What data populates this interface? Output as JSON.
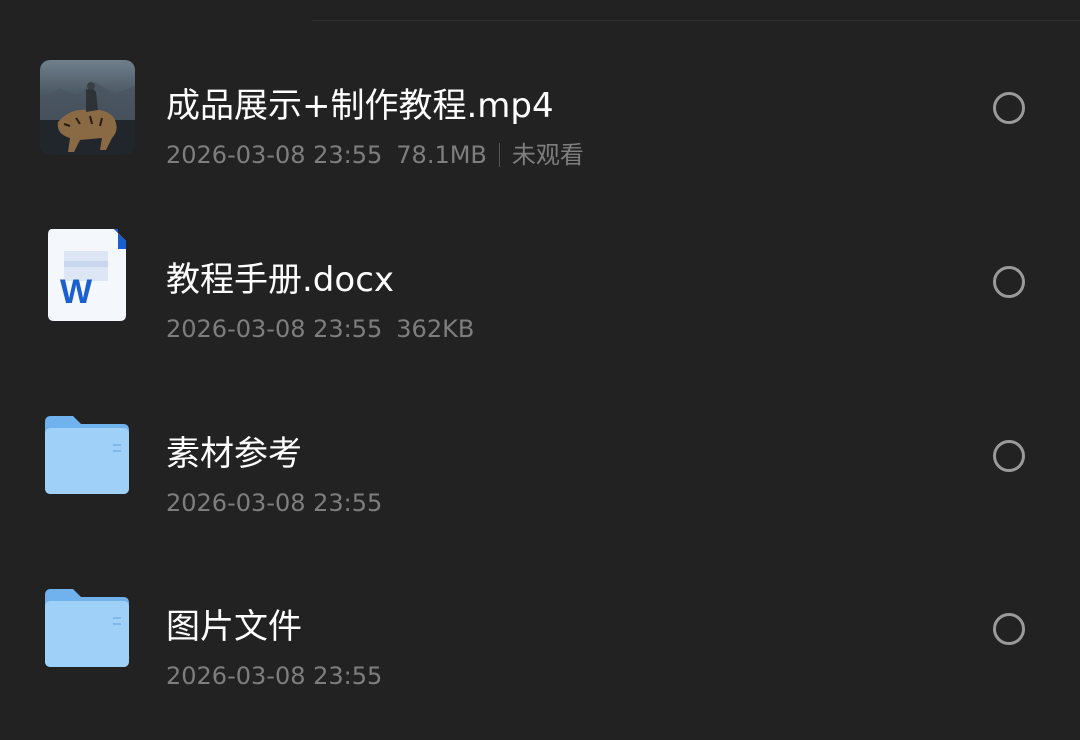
{
  "files": [
    {
      "name": "成品展示+制作教程.mp4",
      "date": "2026-03-08 23:55",
      "size": "78.1MB",
      "status": "未观看",
      "icon": "video-thumbnail-icon"
    },
    {
      "name": "教程手册.docx",
      "date": "2026-03-08 23:55",
      "size": "362KB",
      "icon": "word-document-icon"
    },
    {
      "name": "素材参考",
      "date": "2026-03-08 23:55",
      "icon": "folder-icon"
    },
    {
      "name": "图片文件",
      "date": "2026-03-08 23:55",
      "icon": "folder-icon"
    }
  ],
  "colors": {
    "background": "#222222",
    "name_text": "#ffffff",
    "meta_text": "#7e7e7e",
    "folder_blue": "#8fc6f5",
    "word_blue": "#1a5fd0"
  }
}
